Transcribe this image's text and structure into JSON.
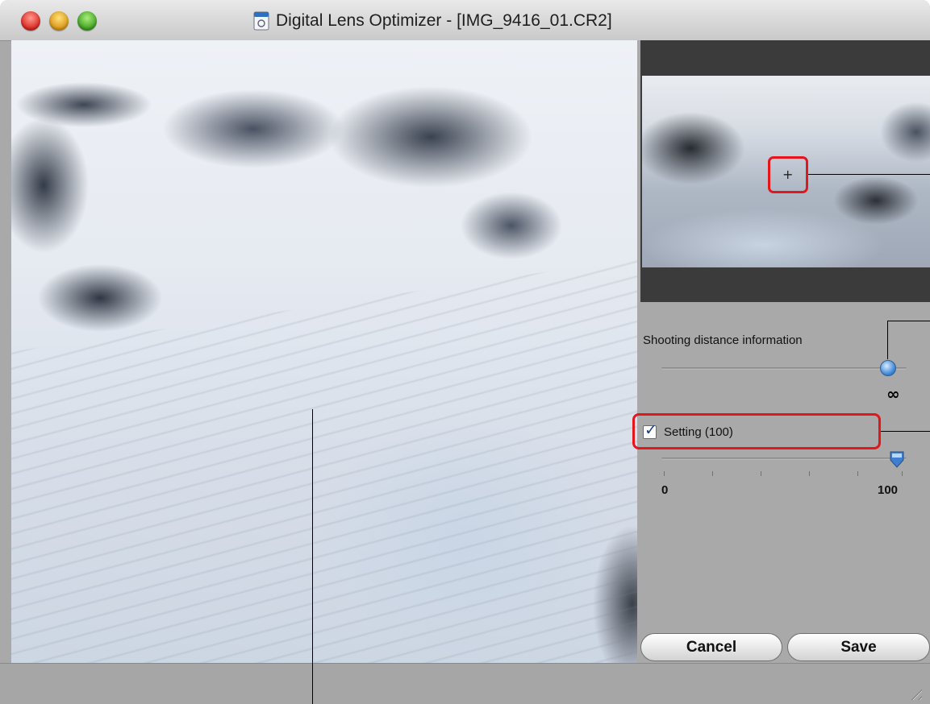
{
  "window": {
    "title": "Digital Lens Optimizer - [IMG_9416_01.CR2]",
    "title_icon": "document-icon"
  },
  "preview": {
    "crosshair_glyph": "+"
  },
  "shooting_distance": {
    "label": "Shooting distance information",
    "value_label": "∞",
    "level": 1.0
  },
  "setting": {
    "label": "Setting (100)",
    "checked": true,
    "value": 100,
    "min_label": "0",
    "max_label": "100"
  },
  "buttons": {
    "cancel": "Cancel",
    "save": "Save"
  },
  "colors": {
    "highlight": "#e3161c",
    "window_bg": "#a9a9a9"
  }
}
